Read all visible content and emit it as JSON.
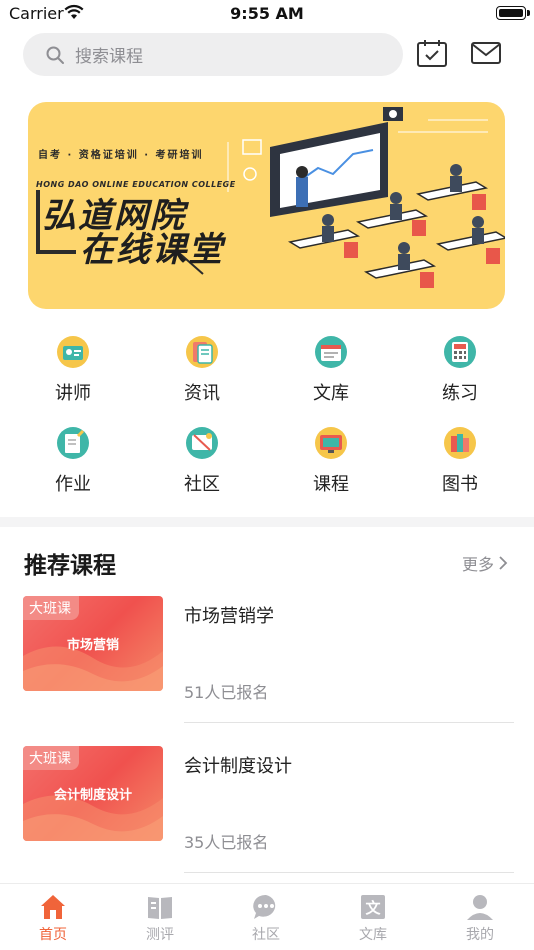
{
  "status_bar": {
    "carrier": "Carrier",
    "time": "9:55 AM"
  },
  "search": {
    "placeholder": "搜索课程"
  },
  "banner": {
    "tagline": "自考 · 资格证培训 · 考研培训",
    "subtitle": "HONG DAO ONLINE EDUCATION COLLEGE",
    "title_line1": "弘道网院",
    "title_line2": "在线课堂"
  },
  "grid": [
    {
      "label": "讲师",
      "icon": "teacher-icon"
    },
    {
      "label": "资讯",
      "icon": "news-icon"
    },
    {
      "label": "文库",
      "icon": "library-icon"
    },
    {
      "label": "练习",
      "icon": "practice-icon"
    },
    {
      "label": "作业",
      "icon": "homework-icon"
    },
    {
      "label": "社区",
      "icon": "community-icon"
    },
    {
      "label": "课程",
      "icon": "course-icon"
    },
    {
      "label": "图书",
      "icon": "books-icon"
    }
  ],
  "recommended": {
    "title": "推荐课程",
    "more": "更多",
    "courses": [
      {
        "tag": "大班课",
        "thumb_title": "市场营销",
        "title": "市场营销学",
        "count": "51人已报名"
      },
      {
        "tag": "大班课",
        "thumb_title": "会计制度设计",
        "title": "会计制度设计",
        "count": "35人已报名"
      }
    ]
  },
  "tabbar": [
    {
      "label": "首页",
      "icon": "home-icon",
      "active": true
    },
    {
      "label": "测评",
      "icon": "assessment-icon",
      "active": false
    },
    {
      "label": "社区",
      "icon": "chat-icon",
      "active": false
    },
    {
      "label": "文库",
      "icon": "document-icon",
      "active": false
    },
    {
      "label": "我的",
      "icon": "profile-icon",
      "active": false
    }
  ],
  "colors": {
    "accent": "#f0643a",
    "banner_bg": "#fdd66e",
    "thumb": "#f0514e"
  }
}
